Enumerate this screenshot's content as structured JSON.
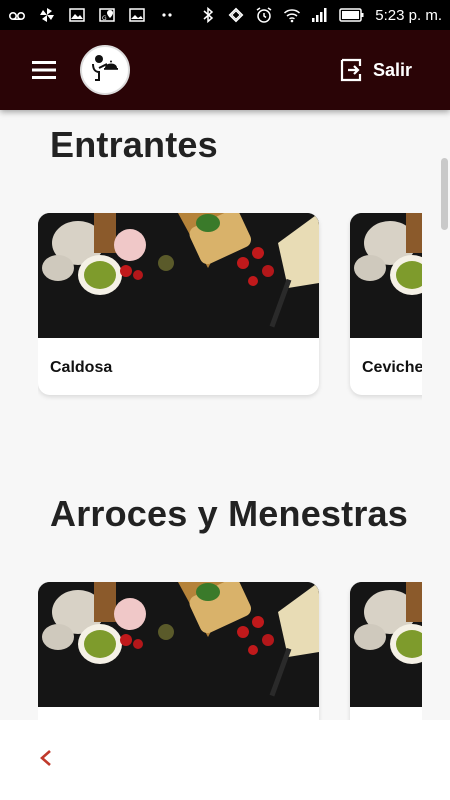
{
  "status_bar": {
    "time": "5:23 p. m.",
    "left_icons": [
      "voicemail-icon",
      "pinwheel-icon",
      "image-icon",
      "map-icon",
      "gallery-icon",
      "dots-icon"
    ],
    "right_icons": [
      "bluetooth-icon",
      "rotate-icon",
      "alarm-icon",
      "wifi-icon",
      "signal-icon",
      "battery-icon"
    ]
  },
  "app_bar": {
    "menu_icon": "hamburger-menu-icon",
    "logo_icon": "waiter-cloche-logo",
    "logout_label": "Salir",
    "logout_icon": "exit-icon",
    "background": "#2a0406"
  },
  "sections": [
    {
      "title": "Entrantes",
      "cards": [
        {
          "label": "Caldosa"
        },
        {
          "label": "Ceviche"
        }
      ]
    },
    {
      "title": "Arroces y Menestras",
      "cards": [
        {
          "label": ""
        },
        {
          "label": ""
        }
      ]
    }
  ],
  "bottom_bar": {
    "back_icon": "chevron-left-icon",
    "accent": "#c0392b"
  }
}
